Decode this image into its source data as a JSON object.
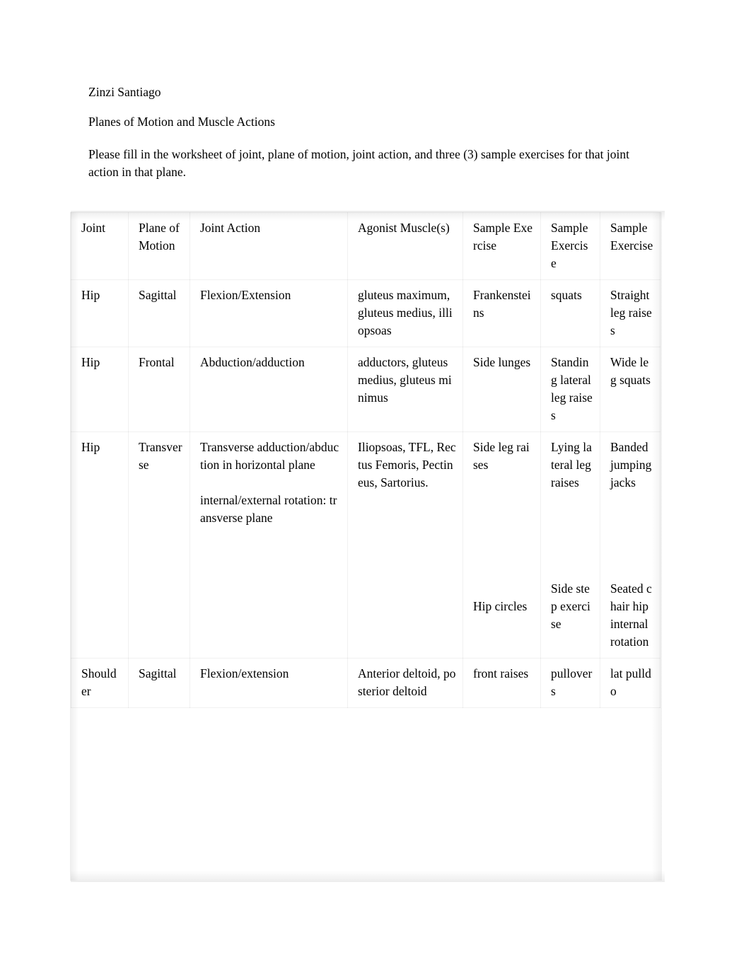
{
  "document": {
    "author": "Zinzi Santiago",
    "title": "Planes of Motion and Muscle Actions",
    "instructions": "Please fill in the worksheet of joint, plane of motion, joint action, and three (3) sample exercises for that joint action in that plane."
  },
  "table": {
    "headers": {
      "joint": "Joint",
      "plane_of_motion": "Plane of Motion",
      "joint_action": "Joint Action",
      "agonist_muscles": "Agonist Muscle(s)",
      "sample_exercise_1": "Sample Exercise",
      "sample_exercise_2": "Sample Exercise",
      "sample_exercise_3": "Sample Exercise"
    },
    "rows": [
      {
        "joint": "Hip",
        "plane_of_motion": "Sagittal",
        "joint_action": "Flexion/Extension",
        "joint_action_2": "",
        "agonist_muscles": "gluteus maximum, gluteus medius, illiopsoas",
        "sample_exercise_1": "Frankensteins",
        "sample_exercise_1b": "",
        "sample_exercise_2": "squats",
        "sample_exercise_2b": "",
        "sample_exercise_3": "Straight leg raises",
        "sample_exercise_3b": ""
      },
      {
        "joint": "Hip",
        "plane_of_motion": "Frontal",
        "joint_action": "Abduction/adduction",
        "joint_action_2": "",
        "agonist_muscles": "adductors, gluteus medius, gluteus minimus",
        "sample_exercise_1": "Side lunges",
        "sample_exercise_1b": "",
        "sample_exercise_2": "Standing lateral leg raises",
        "sample_exercise_2b": "",
        "sample_exercise_3": "Wide leg squats",
        "sample_exercise_3b": ""
      },
      {
        "joint": "Hip",
        "plane_of_motion": "Transverse",
        "joint_action": "Transverse adduction/abduction in horizontal plane",
        "joint_action_2": "internal/external rotation: transverse plane",
        "agonist_muscles": "Iliopsoas, TFL, Rectus Femoris, Pectineus, Sartorius.",
        "sample_exercise_1": "Side leg raises",
        "sample_exercise_1b": "Hip circles",
        "sample_exercise_2": "Lying lateral leg raises",
        "sample_exercise_2b": "Side step exercise",
        "sample_exercise_3": "Banded jumping jacks",
        "sample_exercise_3b": "Seated chair hip internal rotation"
      },
      {
        "joint": "Shoulder",
        "plane_of_motion": "Sagittal",
        "joint_action": "Flexion/extension",
        "joint_action_2": "",
        "agonist_muscles": "Anterior deltoid, posterior deltoid",
        "sample_exercise_1": "front raises",
        "sample_exercise_1b": "",
        "sample_exercise_2": "pullovers",
        "sample_exercise_2b": "",
        "sample_exercise_3": "lat pulldo",
        "sample_exercise_3b": ""
      }
    ]
  }
}
